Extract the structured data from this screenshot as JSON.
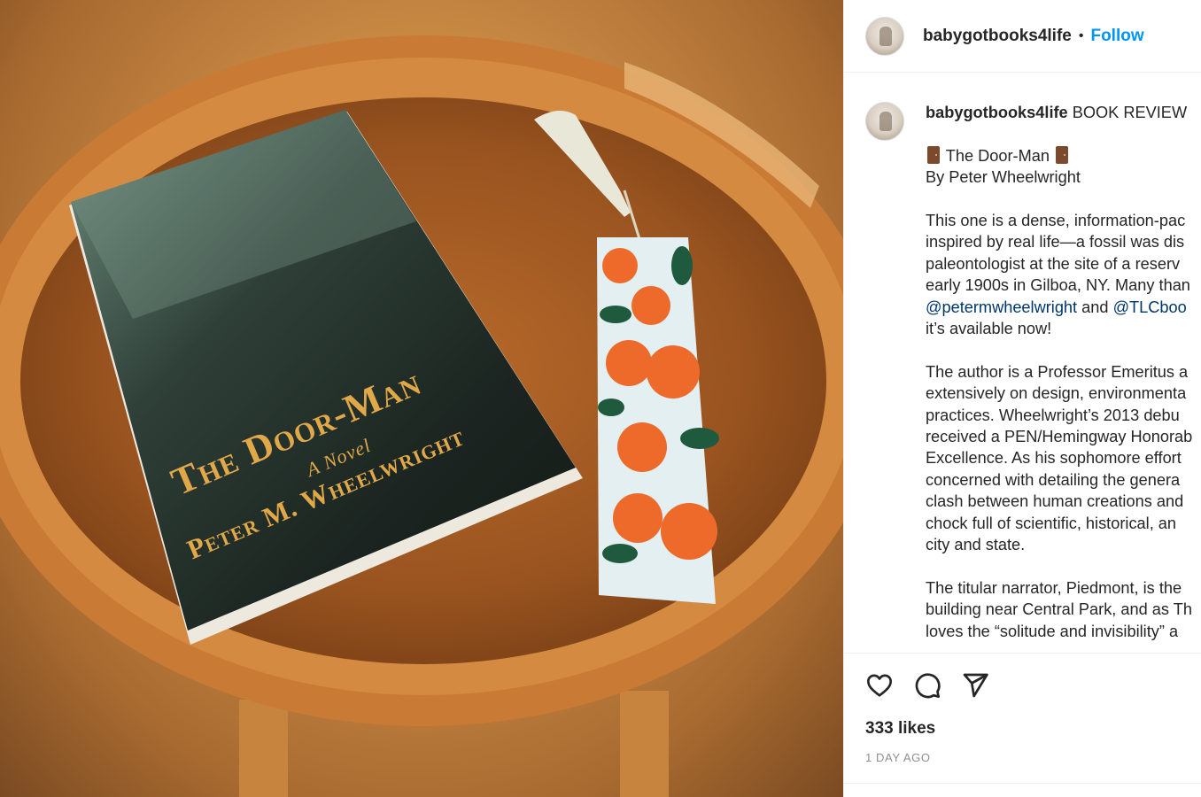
{
  "post": {
    "cover_title": "The Door-Man",
    "cover_subtitle": "A Novel",
    "cover_author": "Peter M. Wheelwright"
  },
  "header": {
    "username": "babygotbooks4life",
    "separator": "•",
    "follow_label": "Follow"
  },
  "caption": {
    "username": "babygotbooks4life",
    "lead": "BOOK REVIEW",
    "title_line": "The Door-Man",
    "byline": "By Peter Wheelwright",
    "para1": [
      "This one is a dense, information-pac",
      "inspired by real life—a fossil was dis",
      "paleontologist at the site of a reserv",
      "early 1900s in Gilboa, NY. Many than"
    ],
    "mention1": "@petermwheelwright",
    "mention_joiner": " and ",
    "mention2": "@TLCboo",
    "para1_end": "it’s available now!",
    "para2": [
      "The author is a Professor Emeritus a",
      "extensively on design, environmenta",
      "practices. Wheelwright’s 2013 debu",
      "received a PEN/Hemingway Honorab",
      "Excellence. As his sophomore effort",
      "concerned with detailing the genera",
      "clash between human creations and",
      "chock full of scientific, historical, an",
      "city and state."
    ],
    "para3": [
      "The titular narrator, Piedmont, is the",
      "building near Central Park, and as Th",
      "loves the “solitude and invisibility” a"
    ]
  },
  "actions": {
    "likes": "333 likes",
    "time": "1 DAY AGO",
    "icons": [
      "heart-icon",
      "comment-icon",
      "share-icon"
    ]
  },
  "colors": {
    "link": "#00376b",
    "follow": "#0095f6",
    "text": "#262626",
    "muted": "#8e8e8e"
  }
}
